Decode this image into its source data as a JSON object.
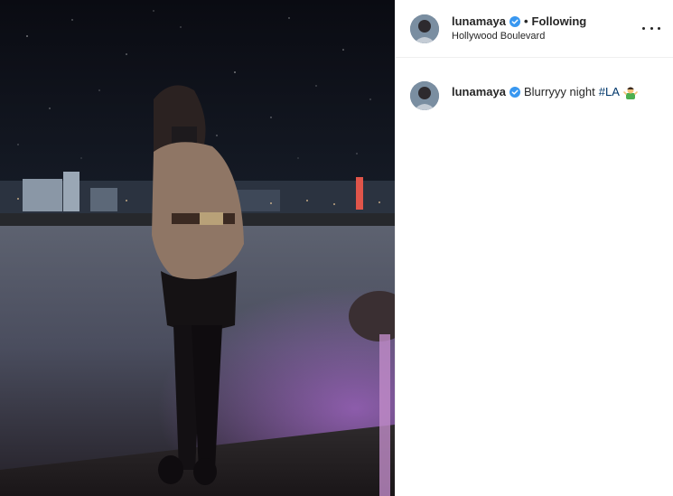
{
  "post": {
    "username": "lunamaya",
    "follow_status": "Following",
    "separator": "•",
    "location": "Hollywood Boulevard",
    "caption_text": "Blurryyy night",
    "hashtag": "#LA",
    "emoji": "person-shrugging-emoji"
  },
  "colors": {
    "verified_badge": "#3897f0",
    "hashtag": "#00376b",
    "text": "#262626",
    "divider": "#efefef"
  },
  "icons": {
    "verified": "verified-badge-icon",
    "more": "more-options-icon"
  }
}
